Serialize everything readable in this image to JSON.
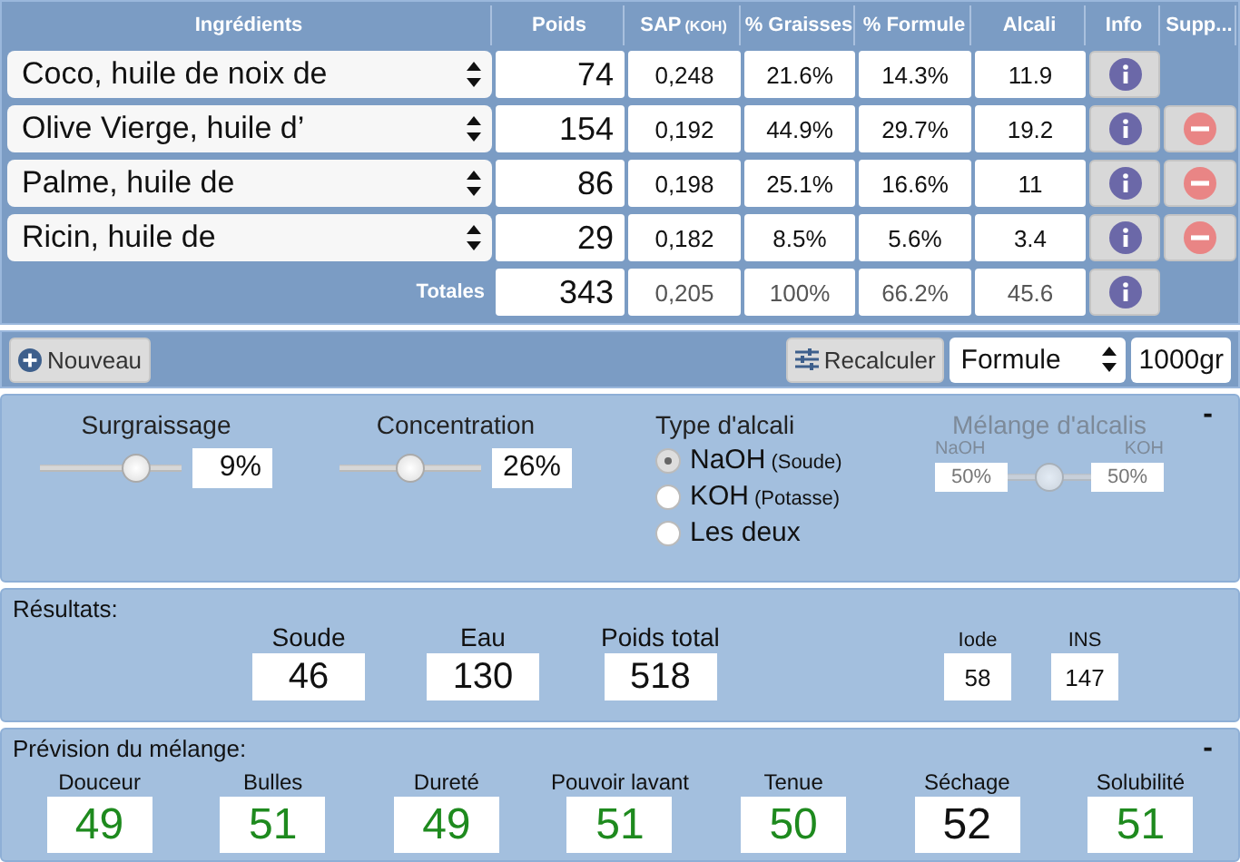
{
  "table": {
    "columns": [
      "Ingrédients",
      "Poids",
      "SAP",
      "(KOH)",
      "% Graisses",
      "% Formule",
      "Alcali",
      "Info",
      "Supp..."
    ],
    "rows": [
      {
        "ingredient": "Coco, huile de noix de",
        "poids": "74",
        "sap": "0,248",
        "graisses": "21.6%",
        "formule": "14.3%",
        "alcali": "11.9",
        "removable": false
      },
      {
        "ingredient": "Olive Vierge, huile d’",
        "poids": "154",
        "sap": "0,192",
        "graisses": "44.9%",
        "formule": "29.7%",
        "alcali": "19.2",
        "removable": true
      },
      {
        "ingredient": "Palme, huile de",
        "poids": "86",
        "sap": "0,198",
        "graisses": "25.1%",
        "formule": "16.6%",
        "alcali": "11",
        "removable": true
      },
      {
        "ingredient": "Ricin, huile de",
        "poids": "29",
        "sap": "0,182",
        "graisses": "8.5%",
        "formule": "5.6%",
        "alcali": "3.4",
        "removable": true
      }
    ],
    "totals": {
      "label": "Totales",
      "poids": "343",
      "sap": "0,205",
      "graisses": "100%",
      "formule": "66.2%",
      "alcali": "45.6"
    }
  },
  "toolbar": {
    "new_button": "Nouveau",
    "recalc_button": "Recalculer",
    "mode_select": "Formule",
    "amount": "1000gr"
  },
  "params": {
    "collapse": "-",
    "sliders": [
      {
        "label": "Surgraissage",
        "level": 0.72,
        "value": "9%"
      },
      {
        "label": "Concentration",
        "level": 0.5,
        "value": "26%"
      }
    ],
    "alkali_type": {
      "label": "Type d'alcali",
      "options": [
        {
          "label": "NaOH",
          "note": "(Soude)",
          "selected": true
        },
        {
          "label": "KOH",
          "note": "(Potasse)",
          "selected": false
        },
        {
          "label": "Les deux",
          "selected": false
        }
      ]
    },
    "mix": {
      "label": "Mélange d'alcalis",
      "disabled": true,
      "left_label": "NaOH",
      "right_label": "KOH",
      "left_value": "50%",
      "right_value": "50%",
      "level": 0.5
    }
  },
  "results": {
    "title": "Résultats:",
    "main": [
      {
        "label": "Soude",
        "value": "46"
      },
      {
        "label": "Eau",
        "value": "130"
      },
      {
        "label": "Poids total",
        "value": "518"
      }
    ],
    "minor": [
      {
        "label": "Iode",
        "value": "58"
      },
      {
        "label": "INS",
        "value": "147"
      }
    ]
  },
  "prevision": {
    "title": "Prévision du mélange:",
    "collapse": "-",
    "items": [
      {
        "label": "Douceur",
        "value": "49",
        "color": "#1e8a1e"
      },
      {
        "label": "Bulles",
        "value": "51",
        "color": "#1e8a1e"
      },
      {
        "label": "Dureté",
        "value": "49",
        "color": "#1e8a1e"
      },
      {
        "label": "Pouvoir lavant",
        "value": "51",
        "color": "#1e8a1e"
      },
      {
        "label": "Tenue",
        "value": "50",
        "color": "#1e8a1e"
      },
      {
        "label": "Séchage",
        "value": "52",
        "color": "#111111"
      },
      {
        "label": "Solubilité",
        "value": "51",
        "color": "#1e8a1e"
      }
    ]
  }
}
